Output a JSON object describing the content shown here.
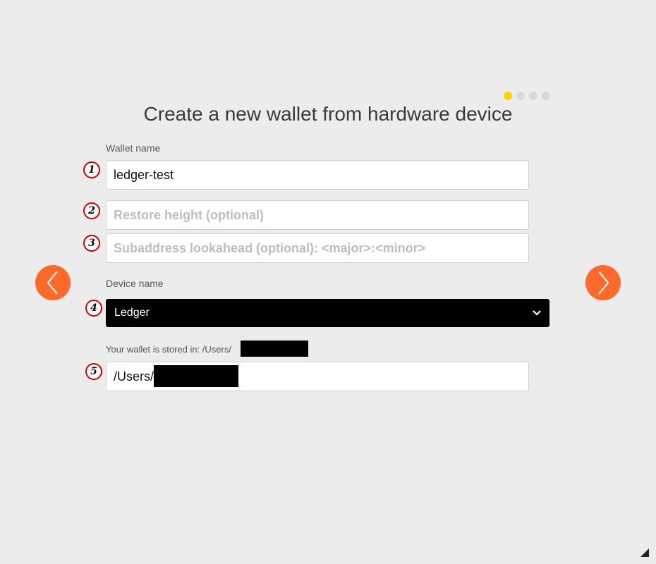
{
  "wizard": {
    "title": "Create a new wallet from hardware device",
    "steps_total": 4,
    "current_step": 1,
    "accent_color": "#ffd500"
  },
  "wallet_name": {
    "label": "Wallet name",
    "value": "ledger-test"
  },
  "restore_height": {
    "placeholder": "Restore height (optional)"
  },
  "subaddress_lookahead": {
    "placeholder": "Subaddress lookahead (optional): <major>:<minor>"
  },
  "device": {
    "label": "Device name",
    "selected": "Ledger"
  },
  "storage": {
    "label": "Your wallet is stored in: /Users/",
    "value": "/Users/"
  },
  "markers": [
    "1",
    "2",
    "3",
    "4",
    "5"
  ],
  "nav": {
    "prev_icon": "chevron-left-icon",
    "next_icon": "chevron-right-icon",
    "color": "#ff6a2b"
  }
}
